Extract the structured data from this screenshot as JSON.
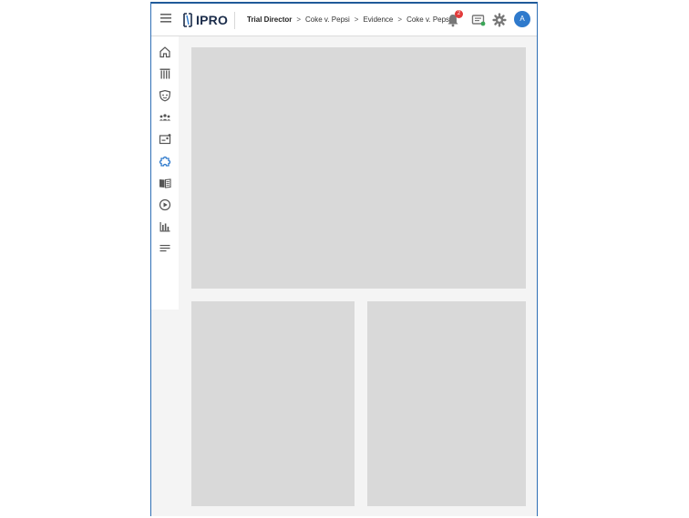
{
  "header": {
    "logo_text": "IPRO",
    "breadcrumb": [
      "Trial Director",
      "Coke v. Pepsi",
      "Evidence",
      "Coke v. Pepsi"
    ],
    "breadcrumb_separator": ">",
    "notification_count": "2",
    "avatar_initial": "A"
  },
  "sidebar": {
    "items": [
      "home-icon",
      "columns-icon",
      "shield-icon",
      "people-icon",
      "id-card-icon",
      "puzzle-icon",
      "book-icon",
      "play-icon",
      "bar-chart-icon",
      "lines-icon"
    ]
  },
  "colors": {
    "accent": "#2f7acc",
    "logo": "#1c2d4b",
    "badge": "#e23b3b",
    "placeholder": "#d9d9d9"
  }
}
